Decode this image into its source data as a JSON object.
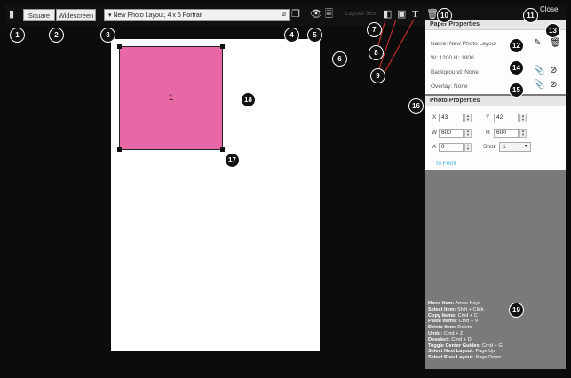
{
  "toolbar": {
    "square_label": "Square",
    "widescreen_label": "Widescreen",
    "layout_select_value": "New Photo Layout, 4 x 6 Portrait",
    "layout_name_label": "Layout Item",
    "close_label": "Close"
  },
  "canvas": {
    "photo_number": "1"
  },
  "paper_properties": {
    "title": "Paper Properties",
    "name": "Name: New Photo Layout",
    "size": "W: 1200 H: 1800",
    "background": "Background: None",
    "overlay": "Overlay: None"
  },
  "photo_properties": {
    "title": "Photo Properties",
    "x_label": "X",
    "x_value": "43",
    "y_label": "Y",
    "y_value": "42",
    "w_label": "W",
    "w_value": "600",
    "h_label": "H",
    "h_value": "600",
    "a_label": "A",
    "a_value": "0",
    "shot_label": "Shot",
    "shot_value": "1",
    "to_front_label": "To Front"
  },
  "shortcuts": [
    {
      "key": "Move Item:",
      "value": " Arrow Keys"
    },
    {
      "key": "Select Item:",
      "value": " Shift + Click"
    },
    {
      "key": "Copy Items:",
      "value": " Cmd + C"
    },
    {
      "key": "Paste Items:",
      "value": " Cmd + V"
    },
    {
      "key": "Delete Item:",
      "value": " Delete"
    },
    {
      "key": "Undo:",
      "value": " Cmd + Z"
    },
    {
      "key": "Deselect:",
      "value": " Cmd + D"
    },
    {
      "key": "Toggle Center Guides:",
      "value": " Cmd + G"
    },
    {
      "key": "Select Next Layout:",
      "value": " Page Up"
    },
    {
      "key": "Select Prev Layout:",
      "value": " Page Down"
    }
  ],
  "callouts": [
    "1",
    "2",
    "3",
    "4",
    "5",
    "6",
    "7",
    "8",
    "9",
    "10",
    "11",
    "12",
    "13",
    "14",
    "15",
    "16",
    "17",
    "18",
    "19"
  ],
  "colors": {
    "photo_fill": "#e868a5",
    "accent_link": "#39b4e0",
    "arrow_red": "#d9302c"
  }
}
